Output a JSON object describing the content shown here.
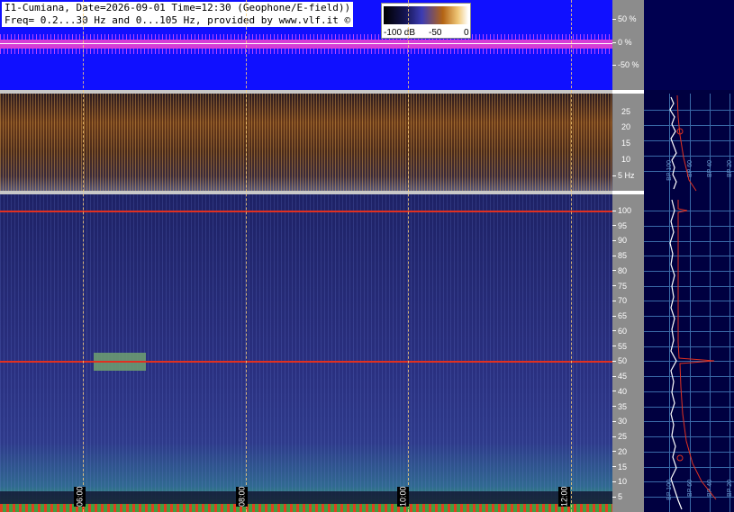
{
  "header": {
    "title_line1": "I1-Cumiana, Date=2026-09-01 Time=12:30 (Geophone/E-field))",
    "title_line2": "Freq= 0.2...30 Hz and 0...105 Hz, provided by www.vlf.it ©"
  },
  "colorbar": {
    "labels": [
      "-100 dB",
      "-50",
      "0"
    ],
    "colors": [
      "#000000",
      "#141450",
      "#3c3cb4",
      "#b46414",
      "#f0c878",
      "#ffffff"
    ]
  },
  "waveform_scale": {
    "labels": [
      "50 %",
      "0 %",
      "-50 %"
    ]
  },
  "spectrogram_low_scale": {
    "labels": [
      "25",
      "20",
      "15",
      "10",
      "5 Hz"
    ]
  },
  "spectrogram_high_scale": {
    "labels": [
      "100",
      "95",
      "90",
      "85",
      "80",
      "75",
      "70",
      "65",
      "60",
      "55",
      "50",
      "45",
      "40",
      "35",
      "30",
      "25",
      "20",
      "15",
      "10",
      "5"
    ]
  },
  "time_axis": {
    "labels": [
      "06:00",
      "08:00",
      "10:00",
      "12:00"
    ]
  },
  "profile_panel": {
    "top_labels": [
      "BP 100",
      "BP 60",
      "BP 40",
      "BP 20"
    ],
    "bottom_labels": [
      "BP 100",
      "BP 60",
      "BP 40",
      "BP 20"
    ]
  },
  "colors": {
    "waveform_bg": "#1010ff",
    "waveform_trace": "#d63cd6",
    "scale_bg": "#8c8c8c",
    "profile_bg": "#000040",
    "grid": "#3a6aa8",
    "marker_red": "#e03020"
  }
}
